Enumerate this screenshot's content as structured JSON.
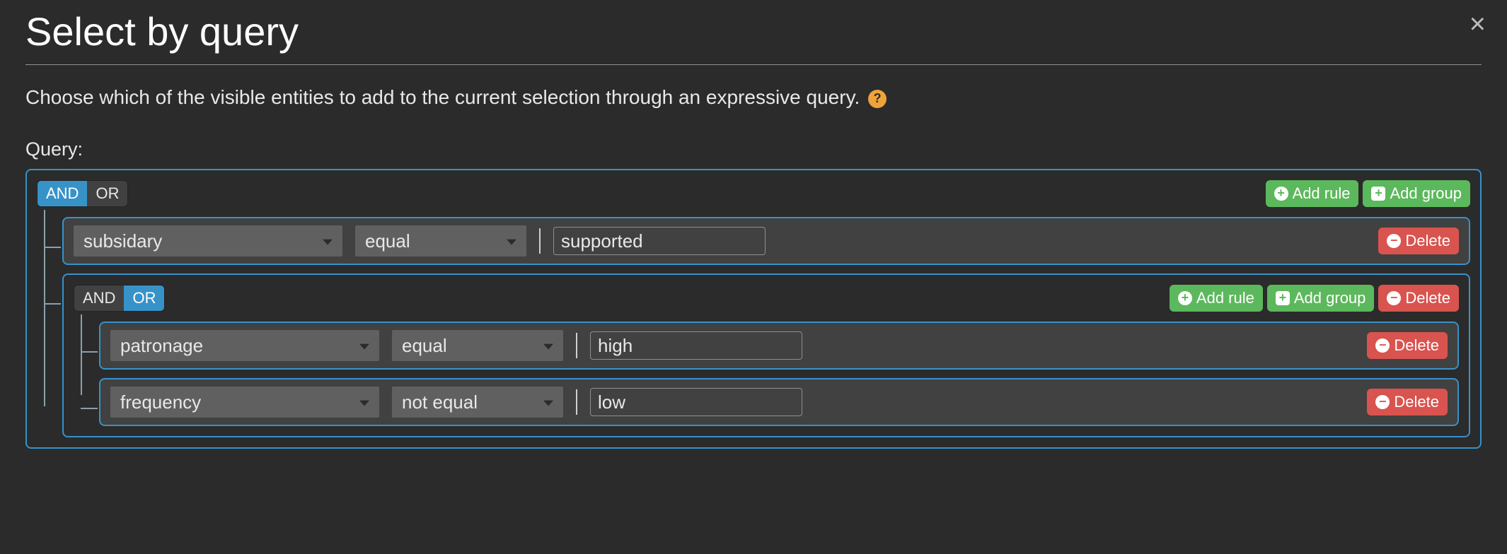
{
  "dialog": {
    "title": "Select by query",
    "description": "Choose which of the visible entities to add to the current selection through an expressive query.",
    "query_label": "Query:"
  },
  "labels": {
    "and": "AND",
    "or": "OR",
    "add_rule": "Add rule",
    "add_group": "Add group",
    "delete": "Delete"
  },
  "root_group": {
    "condition": "AND",
    "rules": [
      {
        "type": "rule",
        "field": "subsidary",
        "operator": "equal",
        "value": "supported"
      },
      {
        "type": "group",
        "condition": "OR",
        "rules": [
          {
            "type": "rule",
            "field": "patronage",
            "operator": "equal",
            "value": "high"
          },
          {
            "type": "rule",
            "field": "frequency",
            "operator": "not equal",
            "value": "low"
          }
        ]
      }
    ]
  }
}
